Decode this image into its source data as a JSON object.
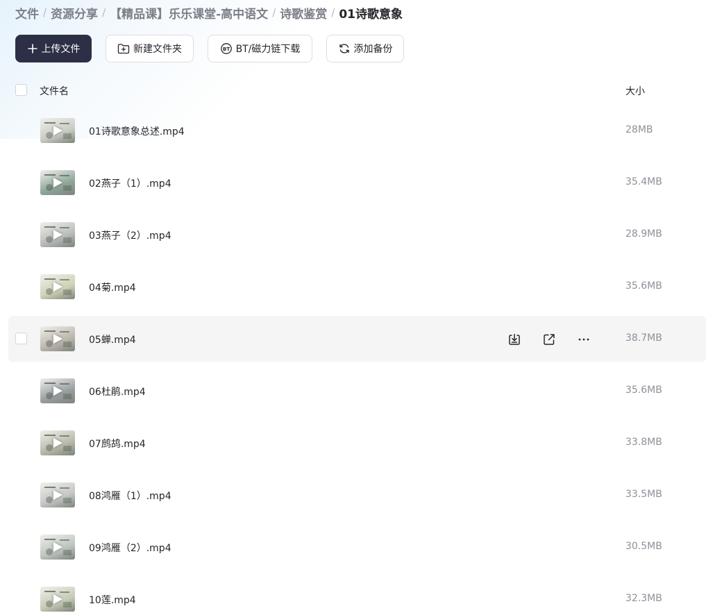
{
  "breadcrumb": [
    {
      "label": "文件",
      "current": false
    },
    {
      "label": "资源分享",
      "current": false
    },
    {
      "label": "【精品课】乐乐课堂-高中语文",
      "current": false
    },
    {
      "label": "诗歌鉴赏",
      "current": false
    },
    {
      "label": "01诗歌意象",
      "current": true
    }
  ],
  "breadcrumb_separator": "/",
  "toolbar": {
    "upload_label": "上传文件",
    "new_folder_label": "新建文件夹",
    "bt_label": "BT/磁力链下载",
    "backup_label": "添加备份"
  },
  "table": {
    "col_name": "文件名",
    "col_size": "大小"
  },
  "files": [
    {
      "name": "01诗歌意象总述.mp4",
      "size": "28MB",
      "thumb_color": "#c9ccc4"
    },
    {
      "name": "02燕子（1）.mp4",
      "size": "35.4MB",
      "thumb_color": "#8fa69a"
    },
    {
      "name": "03燕子（2）.mp4",
      "size": "28.9MB",
      "thumb_color": "#b9bcba"
    },
    {
      "name": "04菊.mp4",
      "size": "35.6MB",
      "thumb_color": "#cfd2b6"
    },
    {
      "name": "05蝉.mp4",
      "size": "38.7MB",
      "thumb_color": "#bdb6ad",
      "hover": true
    },
    {
      "name": "06杜鹃.mp4",
      "size": "35.6MB",
      "thumb_color": "#9a9ea2"
    },
    {
      "name": "07鹧鸪.mp4",
      "size": "33.8MB",
      "thumb_color": "#b8baa8"
    },
    {
      "name": "08鸿雁（1）.mp4",
      "size": "33.5MB",
      "thumb_color": "#c4c6c4"
    },
    {
      "name": "09鸿雁（2）.mp4",
      "size": "30.5MB",
      "thumb_color": "#bfc4c0"
    },
    {
      "name": "10莲.mp4",
      "size": "32.3MB",
      "thumb_color": "#c6cbb6"
    }
  ],
  "row_actions": [
    "download-icon",
    "share-icon",
    "more-icon"
  ],
  "colors": {
    "primary_button": "#2c2f45",
    "hover_row": "#f5f5f6",
    "size_text": "#8e9099"
  }
}
